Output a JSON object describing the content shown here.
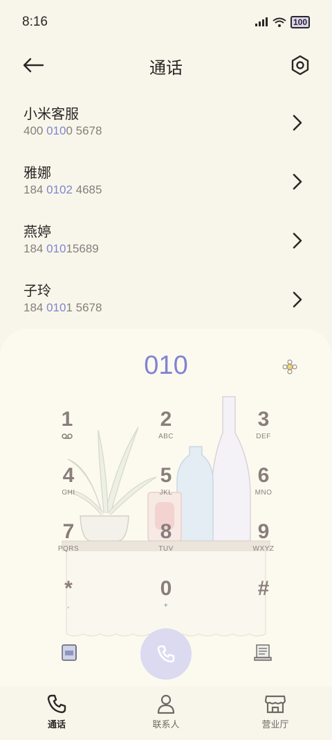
{
  "status_bar": {
    "time": "8:16",
    "battery": "100"
  },
  "header": {
    "title": "通话"
  },
  "contacts": [
    {
      "name": "小米客服",
      "num_pre": "400 ",
      "num_hl": "010",
      "num_post": "0 5678"
    },
    {
      "name": "雅娜",
      "num_pre": "184 ",
      "num_hl": "0102",
      "num_post": " 4685"
    },
    {
      "name": "燕婷",
      "num_pre": "184 ",
      "num_hl": "010",
      "num_post": "15689"
    },
    {
      "name": "子玲",
      "num_pre": "184 ",
      "num_hl": "010",
      "num_post": "1 5678"
    }
  ],
  "dialer": {
    "input": "010",
    "keys": [
      {
        "digit": "1",
        "letters": ""
      },
      {
        "digit": "2",
        "letters": "ABC"
      },
      {
        "digit": "3",
        "letters": "DEF"
      },
      {
        "digit": "4",
        "letters": "GHI"
      },
      {
        "digit": "5",
        "letters": "JKL"
      },
      {
        "digit": "6",
        "letters": "MNO"
      },
      {
        "digit": "7",
        "letters": "PQRS"
      },
      {
        "digit": "8",
        "letters": "TUV"
      },
      {
        "digit": "9",
        "letters": "WXYZ"
      },
      {
        "digit": "*",
        "letters": ","
      },
      {
        "digit": "0",
        "letters": "+"
      },
      {
        "digit": "#",
        "letters": ""
      }
    ]
  },
  "nav": [
    {
      "label": "通话",
      "icon": "phone-icon",
      "active": true
    },
    {
      "label": "联系人",
      "icon": "person-icon",
      "active": false
    },
    {
      "label": "营业厅",
      "icon": "store-icon",
      "active": false
    }
  ],
  "colors": {
    "accent": "#7f84d3",
    "background": "#f8f6ea",
    "call_button": "#dcdaf1"
  }
}
